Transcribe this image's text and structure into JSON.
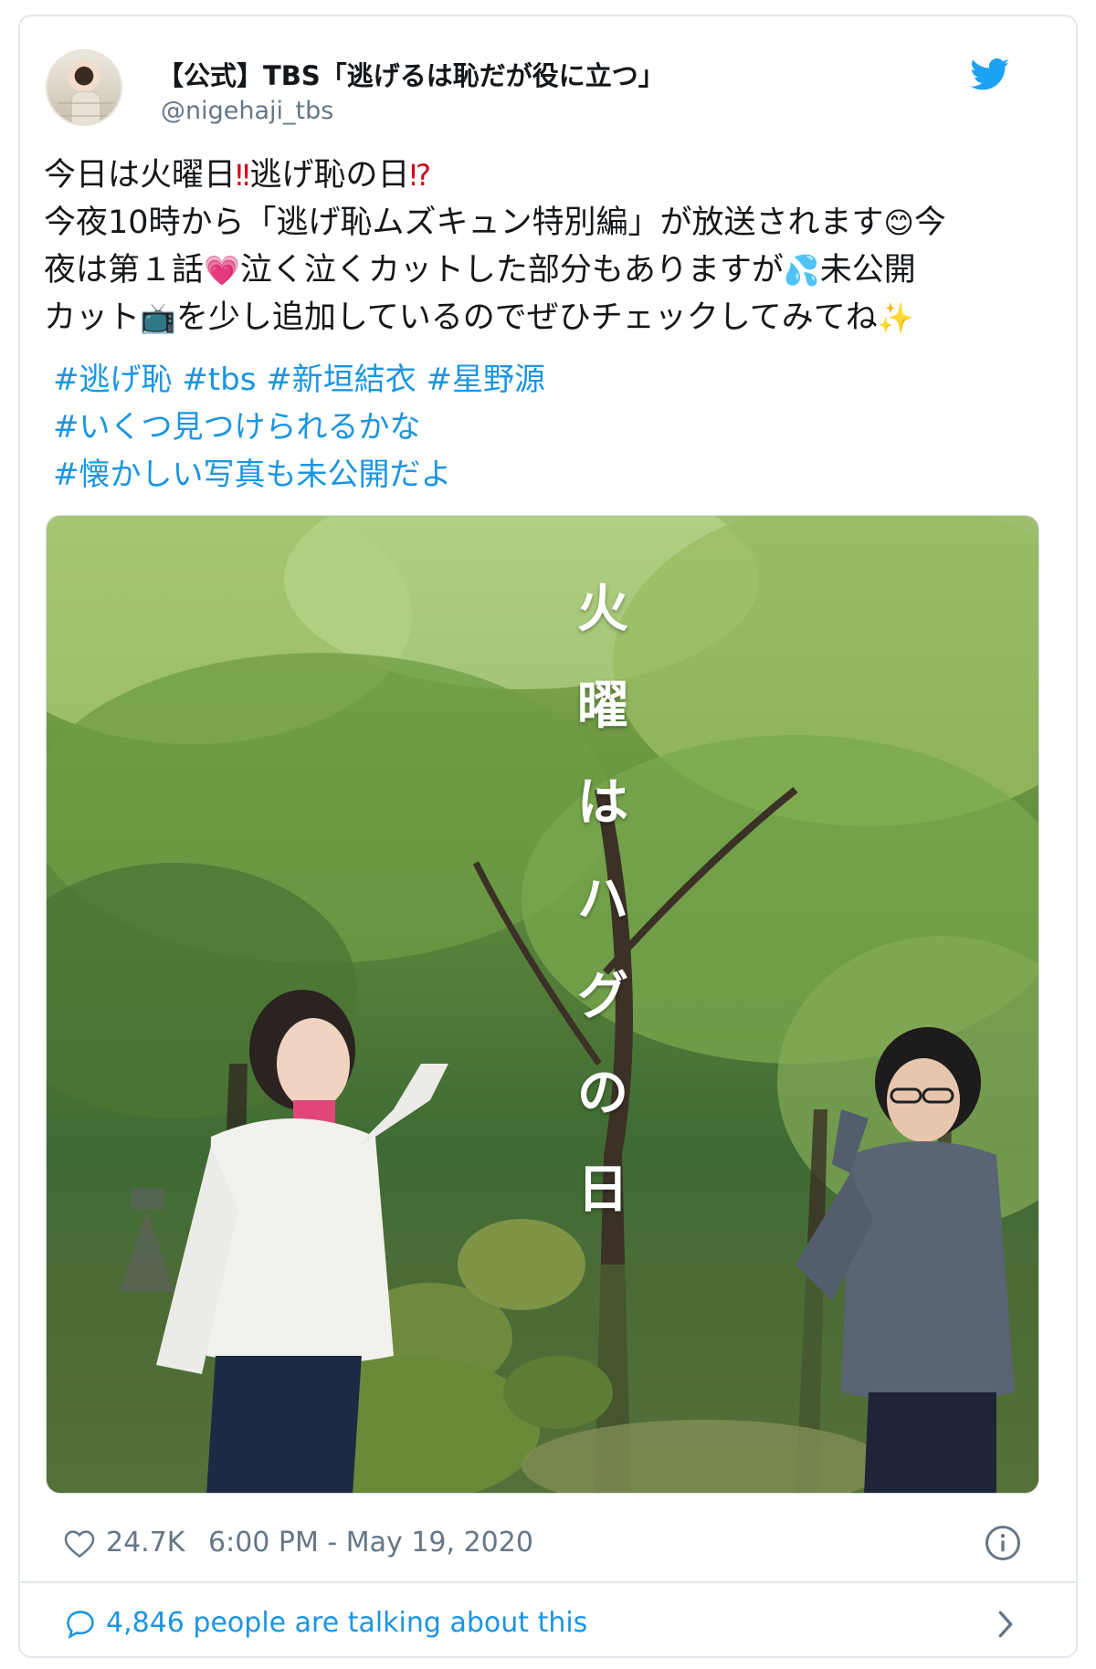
{
  "tweet": {
    "author_name": "【公式】TBS「逃げるは恥だが役に立つ」",
    "author_handle": "@nigehaji_tbs",
    "text_line1_a": "今日は火曜日",
    "text_line1_em1": "‼",
    "text_line1_b": "逃げ恥の日",
    "text_line1_em2": "⁉",
    "text_line2_a": "今夜10時から「逃げ恥ムズキュン特別編」が放送されます",
    "text_line2_em": "😊",
    "text_line2_b": "今",
    "text_line3_a": "夜は第１話",
    "text_line3_em1": "💗",
    "text_line3_b": "泣く泣くカットした部分もありますが",
    "text_line3_em2": "💦",
    "text_line3_c": "未公開",
    "text_line4_a": "カット",
    "text_line4_em1": "📺",
    "text_line4_b": "を少し追加しているのでぜひチェックしてみてね",
    "text_line4_em2": "✨",
    "hashtags_row1": "#逃げ恥 #tbs #新垣結衣 #星野源",
    "hashtags_row2": "#いくつ見つけられるかな",
    "hashtags_row3": "#懐かしい写真も未公開だよ",
    "image_overlay_chars": [
      "火",
      "曜",
      "は",
      "ハ",
      "グ",
      "の",
      "日"
    ],
    "likes": "24.7K",
    "timestamp": "6:00 PM - May 19, 2020",
    "talking": "4,846 people are talking about this"
  },
  "icons": {
    "logo": "twitter-bird-icon",
    "like": "heart-icon",
    "info": "info-icon",
    "reply": "speech-bubble-icon",
    "more": "chevron-right-icon"
  },
  "colors": {
    "link": "#1b95e0",
    "muted": "#657786",
    "text": "#14171a",
    "border": "#e1e8ed"
  }
}
